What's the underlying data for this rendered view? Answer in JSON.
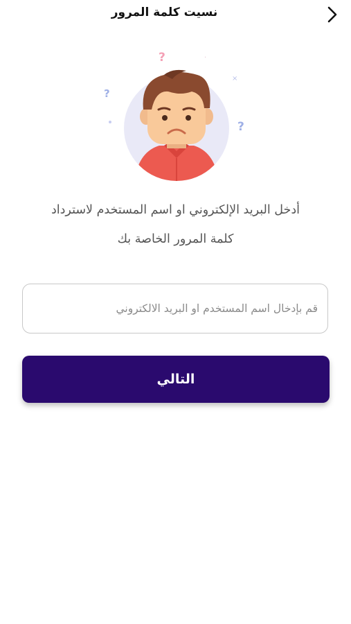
{
  "header": {
    "title": "نسيت كلمة المرور",
    "back_icon": "chevron-right-icon"
  },
  "illustration": {
    "name": "confused-man-illustration",
    "colors": {
      "circle": "#e9e9f7",
      "skin": "#f9c99a",
      "hair": "#8a4a2f",
      "shirt": "#ec5a50",
      "question_pink": "#f4a0b5",
      "question_blue": "#9fb0e6"
    }
  },
  "instructions": {
    "line1": "أدخل البريد الإلكتروني او اسم المستخدم لاسترداد",
    "line2": "كلمة المرور الخاصة بك"
  },
  "form": {
    "identifier": {
      "value": "",
      "placeholder": "قم بإدخال اسم المستخدم او البريد الالكتروني"
    },
    "next_label": "التالي"
  },
  "colors": {
    "primary": "#2a0a6e",
    "text_dark": "#111111",
    "text_muted": "#555555",
    "input_border": "#c8c8c8"
  }
}
